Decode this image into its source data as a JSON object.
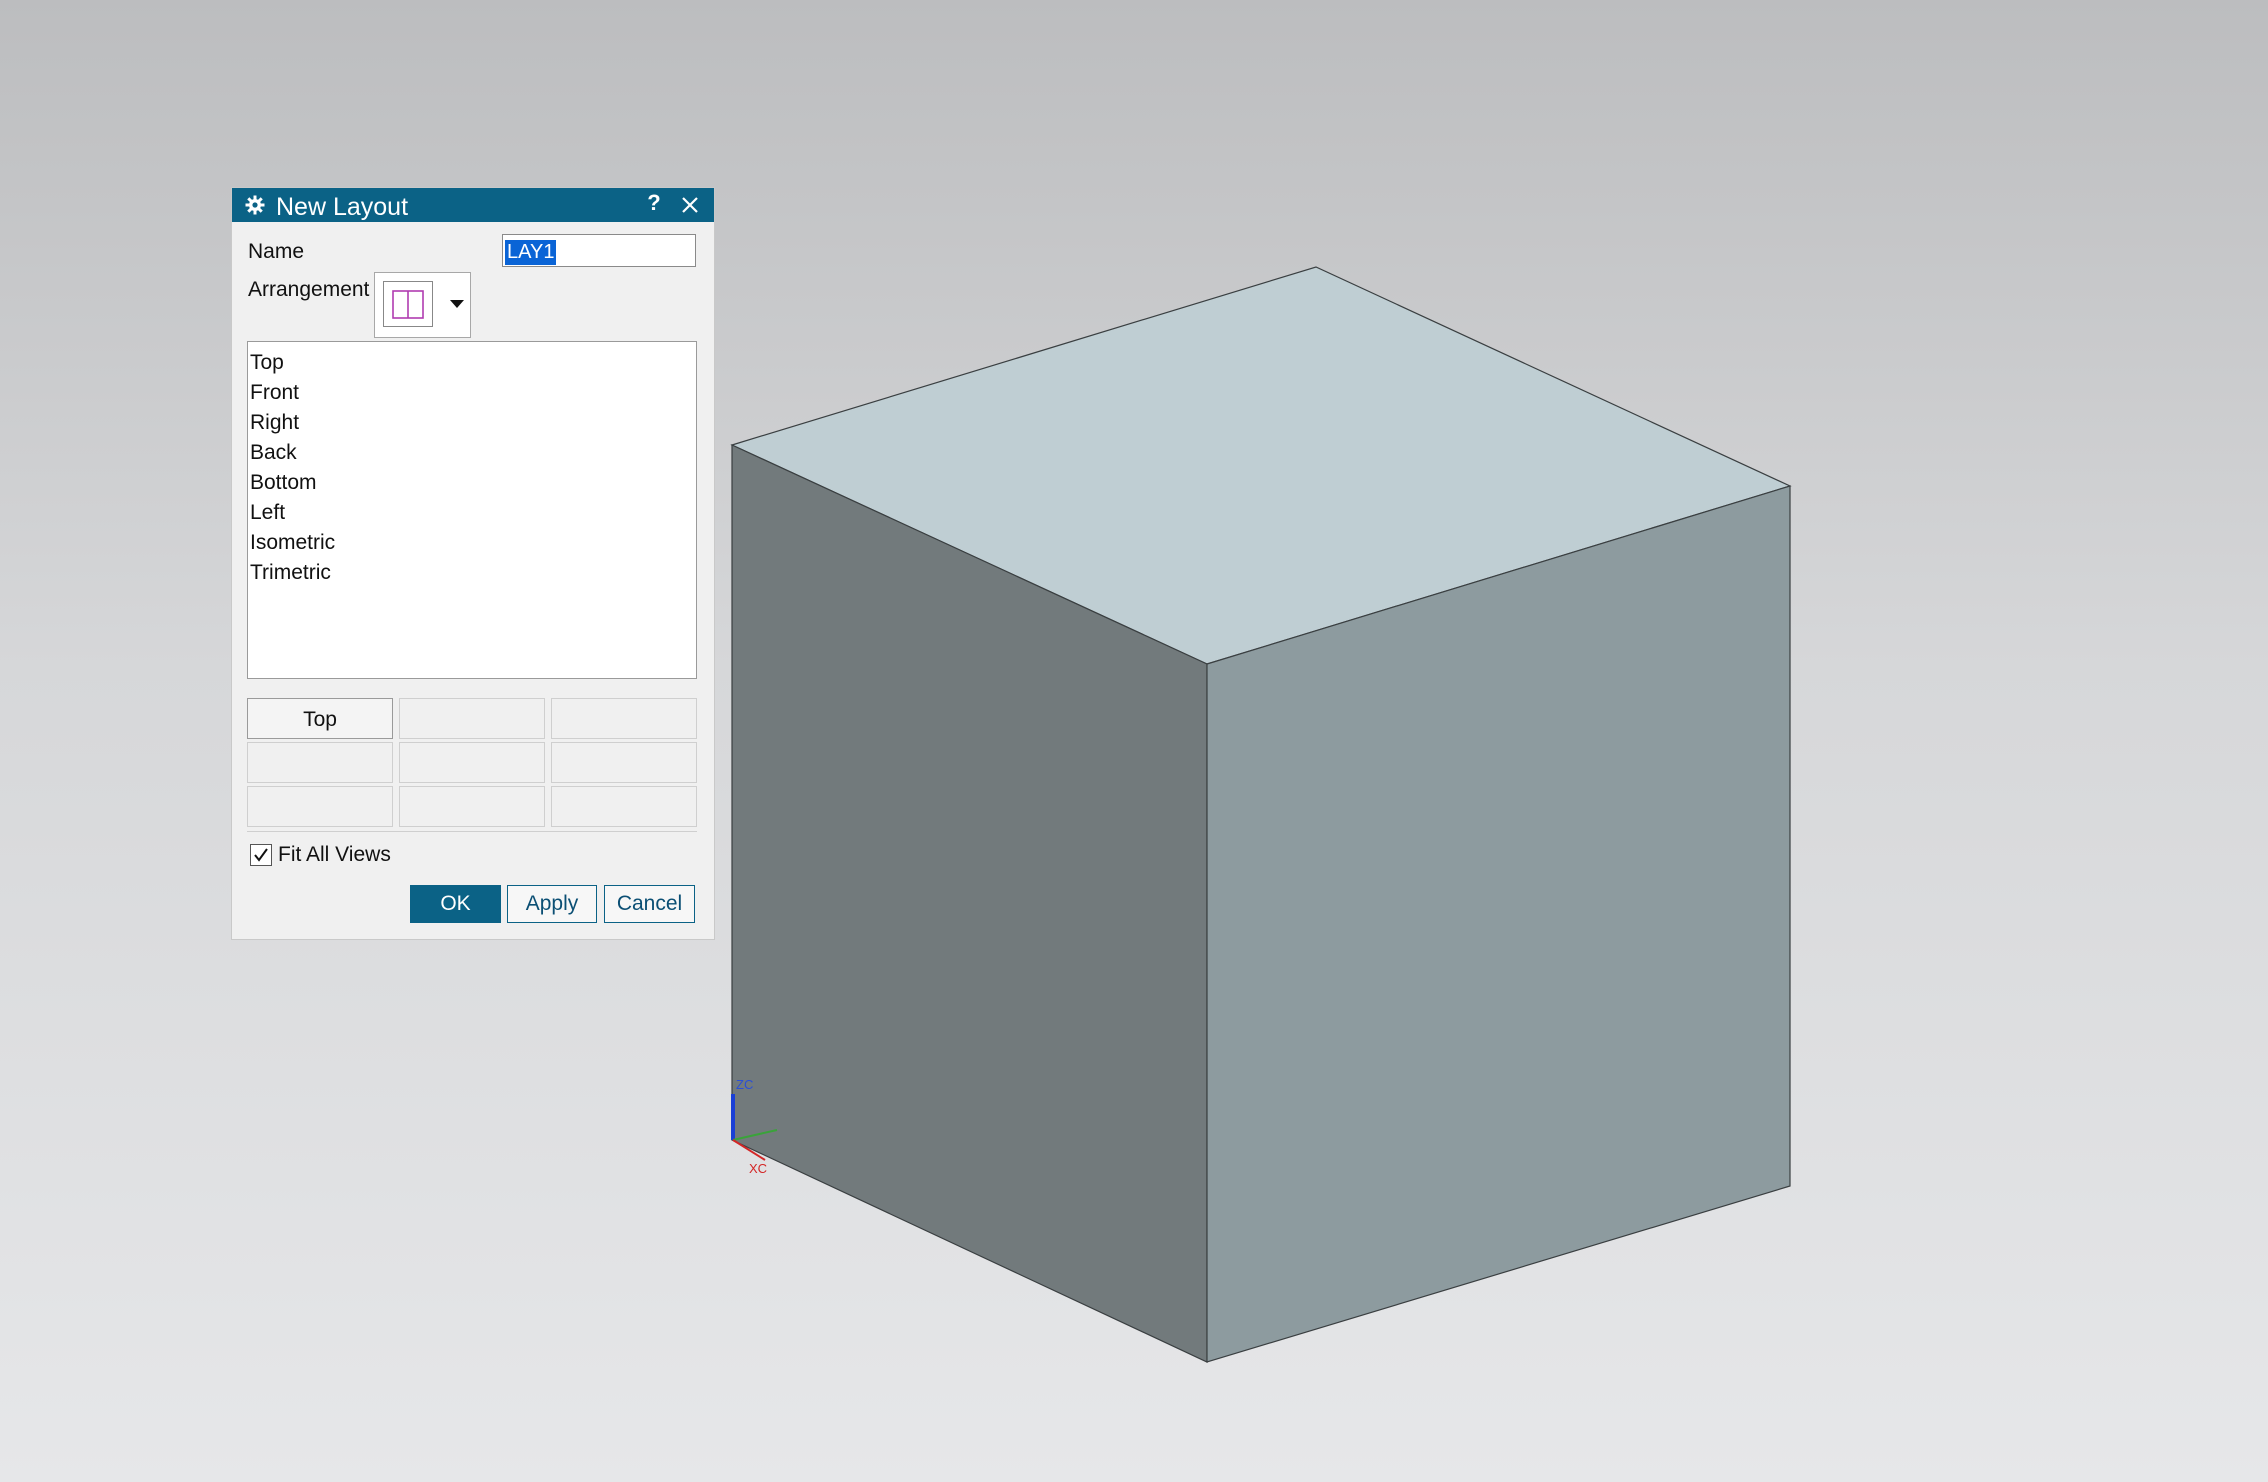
{
  "dialog": {
    "title": "New Layout",
    "help": "?",
    "name_label": "Name",
    "name_value": "LAY1",
    "arrangement_label": "Arrangement",
    "views": [
      "Top",
      "Front",
      "Right",
      "Back",
      "Bottom",
      "Left",
      "Isometric",
      "Trimetric"
    ],
    "grid_cells": [
      "Top",
      "",
      "",
      "",
      "",
      "",
      "",
      "",
      ""
    ],
    "fit_all_views_label": "Fit All Views",
    "fit_all_views_checked": true,
    "ok_label": "OK",
    "apply_label": "Apply",
    "cancel_label": "Cancel"
  },
  "triad": {
    "z_label": "ZC",
    "x_label": "XC"
  },
  "colors": {
    "titlebar": "#0b6286",
    "cube_top": "#bfced3",
    "cube_left": "#727a7c",
    "cube_right": "#8d9b9f",
    "arrangement_icon": "#b03cb0"
  }
}
